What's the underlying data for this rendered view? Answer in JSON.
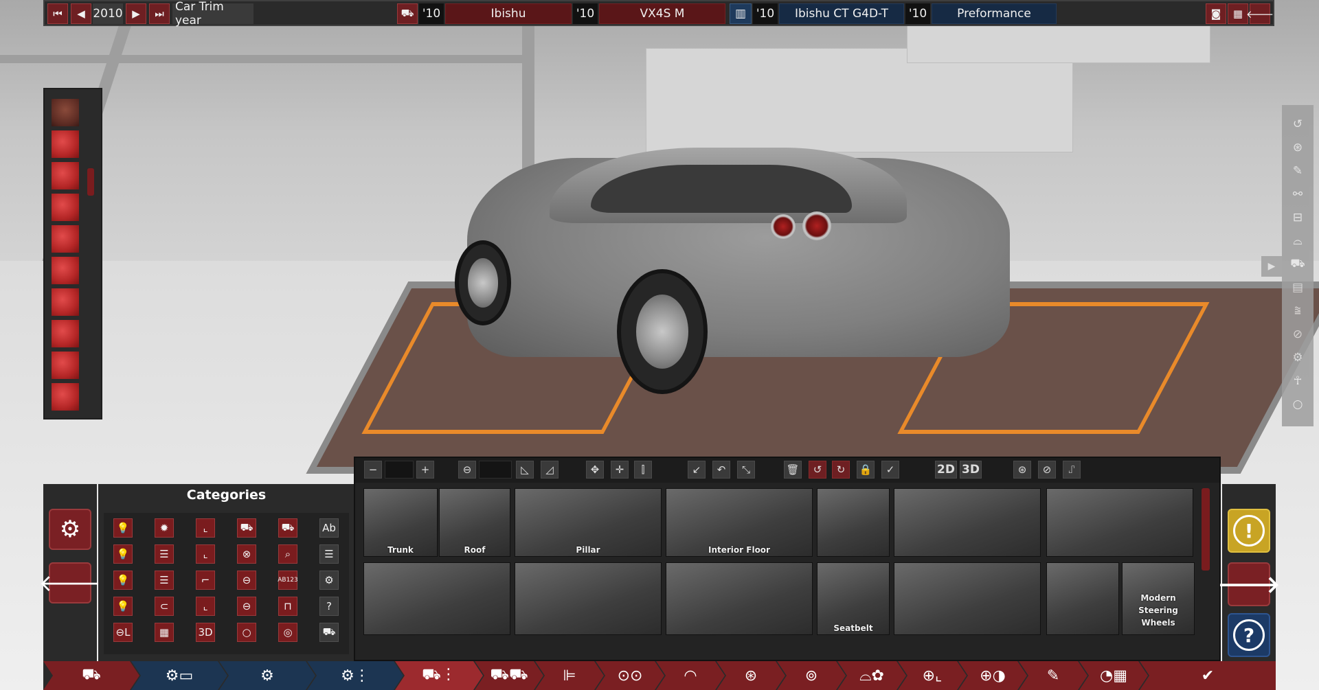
{
  "topbar": {
    "year": "2010",
    "trim_label": "Car Trim year",
    "model_year": "'10",
    "model_name": "Ibishu",
    "trim_year": "'10",
    "trim_name": "VX4S M",
    "engine_year": "'10",
    "engine_name": "Ibishu CT G4D-T",
    "variant_year": "'10",
    "variant_name": "Preformance"
  },
  "categories": {
    "title": "Categories",
    "cells": [
      "💡",
      "✹",
      "⌞",
      "⛟",
      "⛟",
      "Ab",
      "💡",
      "☰",
      "⌞",
      "⊗",
      "⌕",
      "☰",
      "💡",
      "☰",
      "⌐",
      "⊖",
      "AB123",
      "⚙",
      "💡",
      "⊂",
      "⌞",
      "⊖",
      "⊓",
      "?",
      "⊖L",
      "▦",
      "3D",
      "○",
      "◎",
      "⛟"
    ]
  },
  "parts_toolbar": {
    "view_2d": "2D",
    "view_3d": "3D"
  },
  "parts": [
    {
      "label": "Trunk"
    },
    {
      "label": "Roof"
    },
    {
      "label": "Pillar"
    },
    {
      "label": "Interior Floor"
    },
    {
      "label": ""
    },
    {
      "label": ""
    },
    {
      "label": ""
    },
    {
      "label": ""
    },
    {
      "label": ""
    },
    {
      "label": ""
    },
    {
      "label": "Seatbelt"
    },
    {
      "label": ""
    },
    {
      "label": ""
    },
    {
      "label": "Modern Steering Wheels"
    }
  ]
}
